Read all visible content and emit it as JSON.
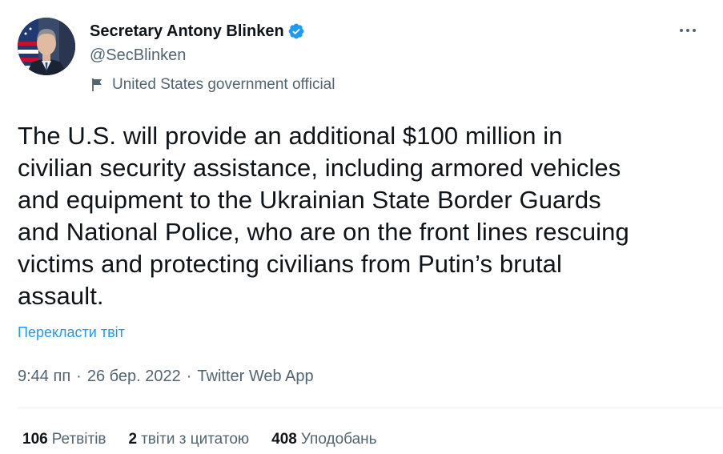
{
  "author": {
    "display_name": "Secretary Antony Blinken",
    "handle": "@SecBlinken",
    "verified_icon": "verified-badge-icon",
    "affiliation_label": "United States government official",
    "affiliation_icon": "flag-icon"
  },
  "tweet": {
    "text": "The U.S. will provide an additional $100 million in\ncivilian security assistance, including armored vehicles\nand equipment to the Ukrainian State Border Guards\nand National Police, who are on the front lines rescuing\nvictims and protecting civilians from Putin’s brutal\nassault.",
    "translate_label": "Перекласти твіт",
    "time": "9:44 пп",
    "date": "26 бер. 2022",
    "source": "Twitter Web App",
    "separator": "·"
  },
  "stats": {
    "retweets_count": "106",
    "retweets_label": "Ретвітів",
    "quotes_count": "2",
    "quotes_label": "твіти з цитатою",
    "likes_count": "408",
    "likes_label": "Уподобань"
  },
  "colors": {
    "accent": "#1d9bf0",
    "text_primary": "#0f1419",
    "text_secondary": "#536471",
    "divider": "#eff3f4"
  }
}
